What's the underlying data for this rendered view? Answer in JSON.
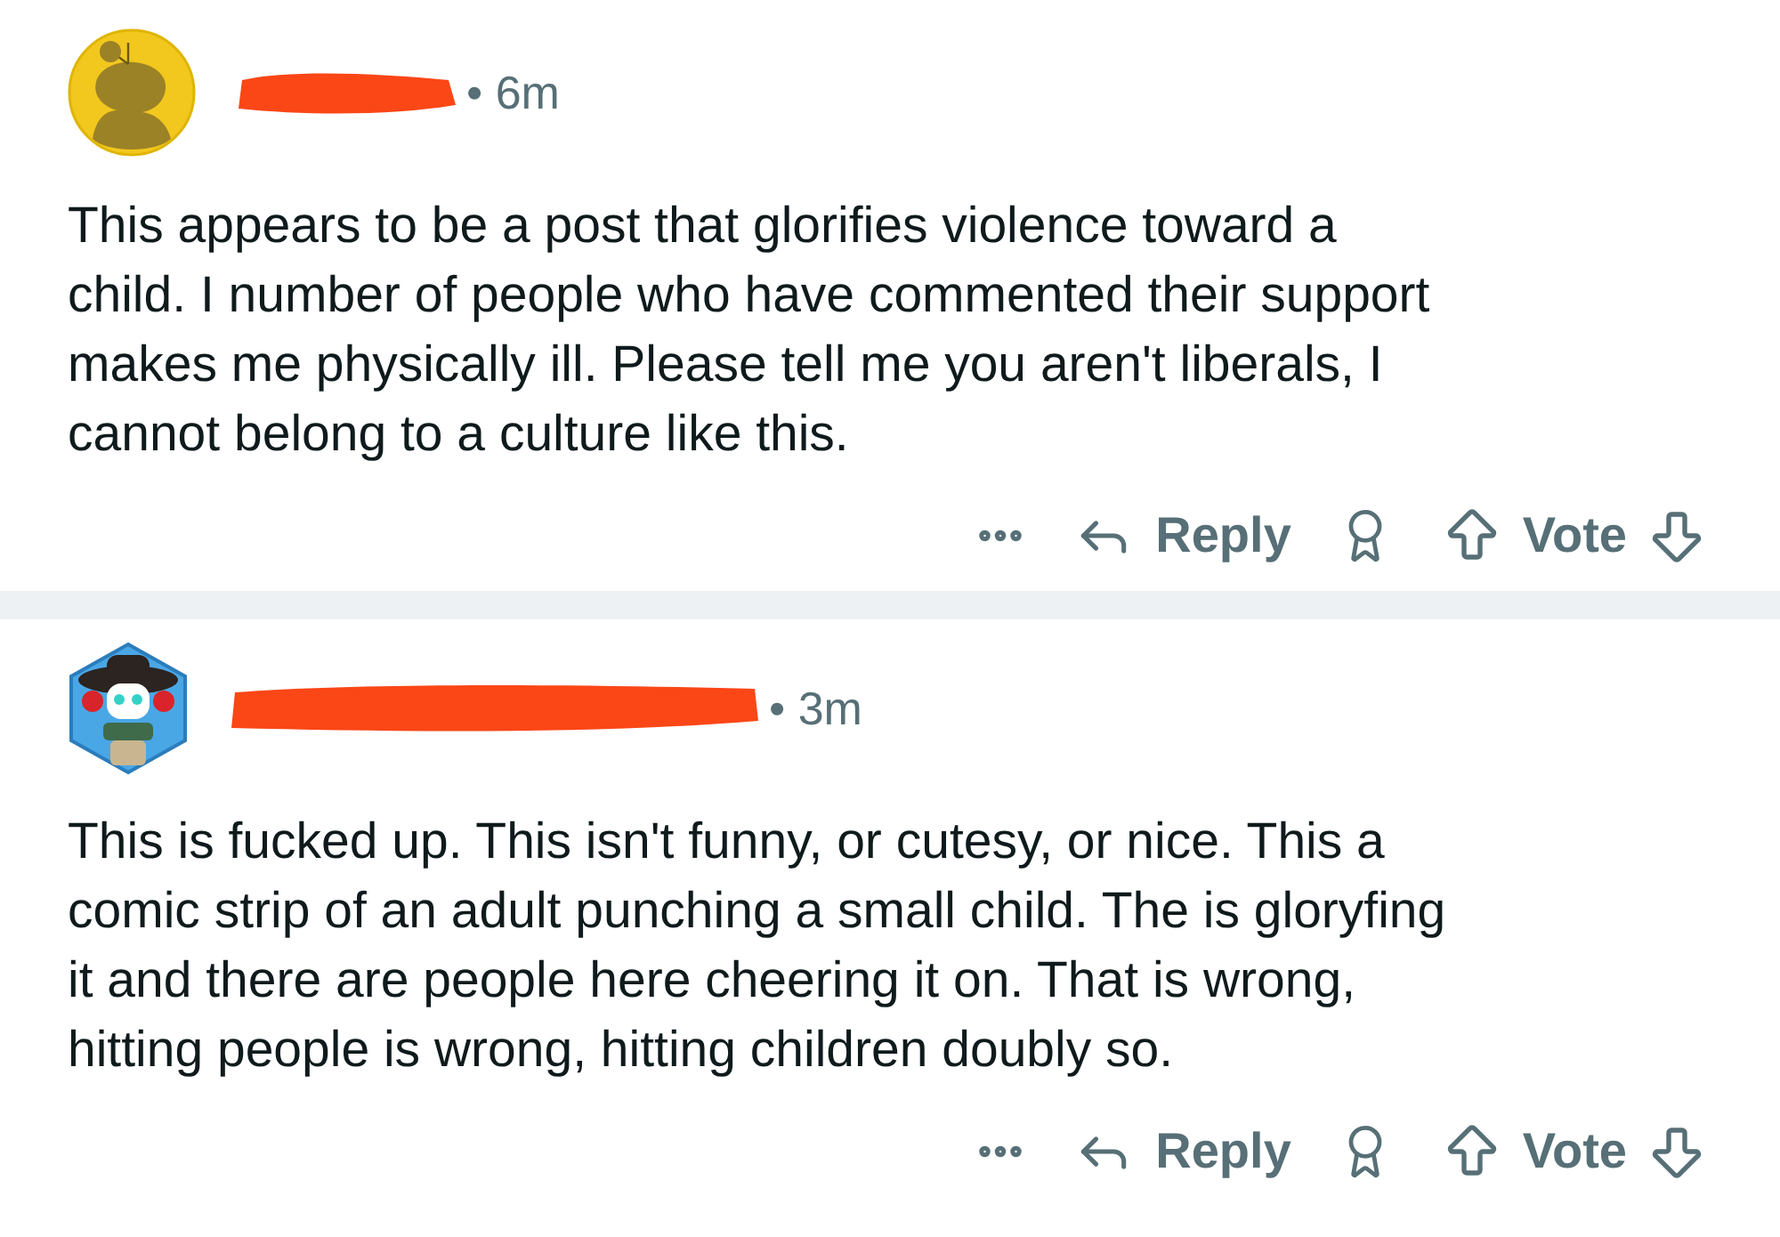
{
  "comments": [
    {
      "avatar": {
        "kind": "circle"
      },
      "time": "• 6m",
      "body": "This appears to be a post that glorifies violence toward a\nchild. I number of people who have commented their support\nmakes me physically ill. Please tell me you aren't liberals, I\ncannot belong to a culture like this.",
      "actions": {
        "reply": "Reply",
        "vote": "Vote"
      }
    },
    {
      "avatar": {
        "kind": "hexagon"
      },
      "time": "• 3m",
      "body": "This is fucked up. This isn't funny, or cutesy, or nice. This a\ncomic strip of an adult punching a small child. The is gloryfing\nit and there are people here cheering it on. That is wrong,\nhitting people is wrong, hitting children doubly so.",
      "actions": {
        "reply": "Reply",
        "vote": "Vote"
      }
    }
  ]
}
